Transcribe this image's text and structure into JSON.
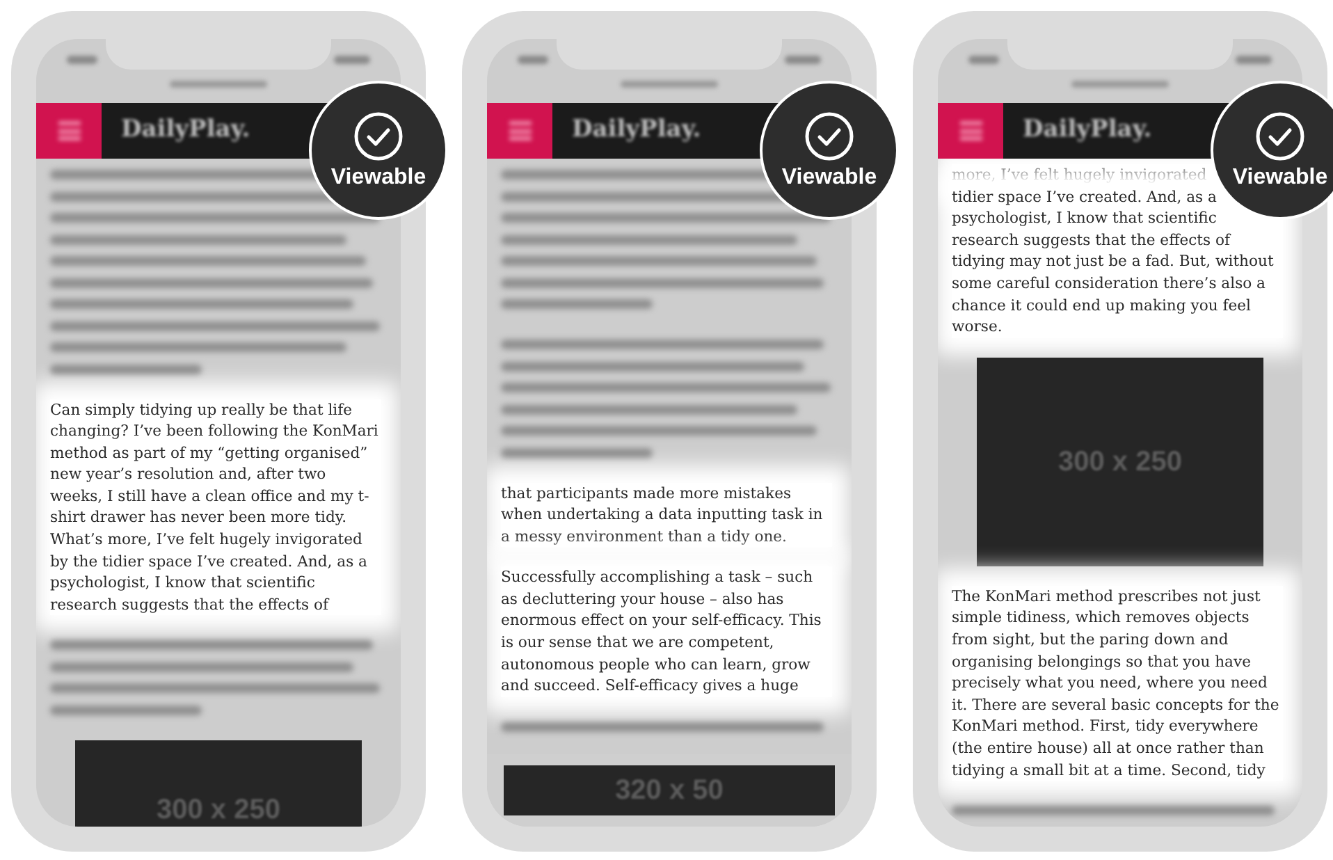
{
  "phones": [
    {
      "site_title": "DailyPlay.",
      "badge": "Viewable",
      "blocks": [
        {
          "kind": "blurred"
        },
        {
          "kind": "text",
          "text": "Can simply tidying up really be that life changing? I’ve been following the KonMari method as part of my “getting organised” new year’s resolution and, after two weeks, I still have a clean office and my t-shirt drawer has never been more tidy. What’s more, I’ve felt hugely invigorated by the tidier space I’ve created. And, as a psychologist, I know that scientific research suggests that the effects of"
        },
        {
          "kind": "blurred"
        },
        {
          "kind": "ad",
          "label": "300 x 250"
        }
      ]
    },
    {
      "site_title": "DailyPlay.",
      "badge": "Viewable",
      "blocks": [
        {
          "kind": "blurred"
        },
        {
          "kind": "blurred"
        },
        {
          "kind": "text",
          "text": "that participants made more mistakes when undertaking a data inputting task in a messy environment than a tidy one."
        },
        {
          "kind": "text",
          "text": "Successfully accomplishing a task – such as decluttering your house – also has enormous effect on your self-efficacy. This is our sense that we are competent, autonomous people who can learn, grow and succeed. Self-efficacy gives a huge"
        },
        {
          "kind": "blurred"
        },
        {
          "kind": "sticky_ad",
          "label": "320 x 50"
        }
      ]
    },
    {
      "site_title": "DailyPlay.",
      "badge": "Viewable",
      "blocks": [
        {
          "kind": "text",
          "text": "more, I’ve felt hugely invigorated"
        },
        {
          "kind": "text",
          "text": "tidier space I’ve created. And, as a psychologist, I know that scientific research suggests that the effects of tidying may not just be a fad. But, without some careful consideration there’s also a chance it could end up making you feel worse."
        },
        {
          "kind": "ad",
          "label": "300 x 250"
        },
        {
          "kind": "text",
          "text": "The KonMari method prescribes not just simple tidiness, which removes objects from sight, but the paring down and organising belongings so that you have precisely what you need, where you need it. There are several basic concepts for the KonMari method. First, tidy everywhere (the entire house) all at once rather than tidying a small bit at a time. Second, tidy"
        },
        {
          "kind": "blurred"
        }
      ]
    }
  ]
}
